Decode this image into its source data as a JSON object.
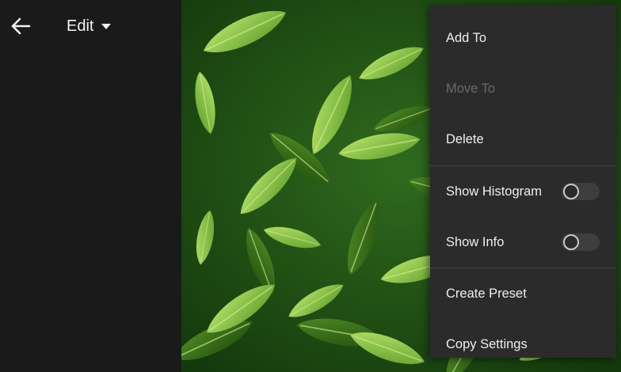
{
  "header": {
    "back_icon": "arrow-left-icon",
    "mode_label": "Edit",
    "mode_icon": "caret-down-icon"
  },
  "photo": {
    "subject": "green tea leaves"
  },
  "menu": {
    "add_to": "Add To",
    "move_to": "Move To",
    "delete": "Delete",
    "show_histogram": "Show Histogram",
    "show_histogram_on": false,
    "show_info": "Show Info",
    "show_info_on": false,
    "create_preset": "Create Preset",
    "copy_settings": "Copy Settings"
  },
  "colors": {
    "background": "#1a1a1a",
    "menu_bg": "#2b2b2b",
    "text": "#eeeeee",
    "disabled_text": "#6a6a6a"
  }
}
